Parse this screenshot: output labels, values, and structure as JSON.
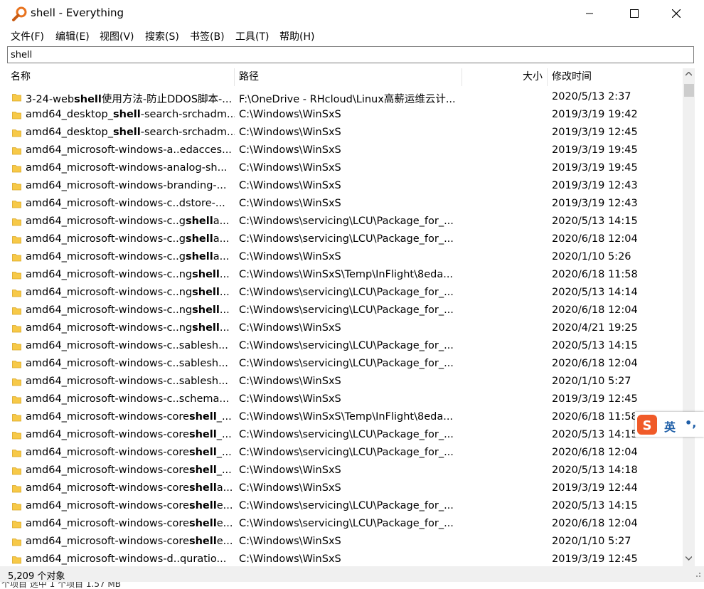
{
  "window": {
    "title": "shell - Everything"
  },
  "menu": [
    "文件(F)",
    "编辑(E)",
    "视图(V)",
    "搜索(S)",
    "书签(B)",
    "工具(T)",
    "帮助(H)"
  ],
  "search": {
    "value": "shell"
  },
  "columns": {
    "name": "名称",
    "path": "路径",
    "size": "大小",
    "modified": "修改时间"
  },
  "rows": [
    {
      "name": "3-24-webshell使用方法-防止DDOS脚本-...",
      "path": "F:\\OneDrive - RHcloud\\Linux高薪运维云计...",
      "date": "2020/5/13 2:37"
    },
    {
      "name": "amd64_desktop_shell-search-srchadm...",
      "path": "C:\\Windows\\WinSxS",
      "date": "2019/3/19 19:42"
    },
    {
      "name": "amd64_desktop_shell-search-srchadm...",
      "path": "C:\\Windows\\WinSxS",
      "date": "2019/3/19 12:45"
    },
    {
      "name": "amd64_microsoft-windows-a..edacces...",
      "path": "C:\\Windows\\WinSxS",
      "date": "2019/3/19 19:45"
    },
    {
      "name": "amd64_microsoft-windows-analog-sh...",
      "path": "C:\\Windows\\WinSxS",
      "date": "2019/3/19 19:45"
    },
    {
      "name": "amd64_microsoft-windows-branding-...",
      "path": "C:\\Windows\\WinSxS",
      "date": "2019/3/19 12:43"
    },
    {
      "name": "amd64_microsoft-windows-c..dstore-...",
      "path": "C:\\Windows\\WinSxS",
      "date": "2019/3/19 12:43"
    },
    {
      "name": "amd64_microsoft-windows-c..gshella...",
      "path": "C:\\Windows\\servicing\\LCU\\Package_for_...",
      "date": "2020/5/13 14:15"
    },
    {
      "name": "amd64_microsoft-windows-c..gshella...",
      "path": "C:\\Windows\\servicing\\LCU\\Package_for_...",
      "date": "2020/6/18 12:04"
    },
    {
      "name": "amd64_microsoft-windows-c..gshella...",
      "path": "C:\\Windows\\WinSxS",
      "date": "2020/1/10 5:26"
    },
    {
      "name": "amd64_microsoft-windows-c..ngshell...",
      "path": "C:\\Windows\\WinSxS\\Temp\\InFlight\\8eda...",
      "date": "2020/6/18 11:58"
    },
    {
      "name": "amd64_microsoft-windows-c..ngshell...",
      "path": "C:\\Windows\\servicing\\LCU\\Package_for_...",
      "date": "2020/5/13 14:14"
    },
    {
      "name": "amd64_microsoft-windows-c..ngshell...",
      "path": "C:\\Windows\\servicing\\LCU\\Package_for_...",
      "date": "2020/6/18 12:04"
    },
    {
      "name": "amd64_microsoft-windows-c..ngshell...",
      "path": "C:\\Windows\\WinSxS",
      "date": "2020/4/21 19:25"
    },
    {
      "name": "amd64_microsoft-windows-c..sablesh...",
      "path": "C:\\Windows\\servicing\\LCU\\Package_for_...",
      "date": "2020/5/13 14:15"
    },
    {
      "name": "amd64_microsoft-windows-c..sablesh...",
      "path": "C:\\Windows\\servicing\\LCU\\Package_for_...",
      "date": "2020/6/18 12:04"
    },
    {
      "name": "amd64_microsoft-windows-c..sablesh...",
      "path": "C:\\Windows\\WinSxS",
      "date": "2020/1/10 5:27"
    },
    {
      "name": "amd64_microsoft-windows-c..schema...",
      "path": "C:\\Windows\\WinSxS",
      "date": "2019/3/19 12:45"
    },
    {
      "name": "amd64_microsoft-windows-coreshell_...",
      "path": "C:\\Windows\\WinSxS\\Temp\\InFlight\\8eda...",
      "date": "2020/6/18 11:58"
    },
    {
      "name": "amd64_microsoft-windows-coreshell_...",
      "path": "C:\\Windows\\servicing\\LCU\\Package_for_...",
      "date": "2020/5/13 14:15"
    },
    {
      "name": "amd64_microsoft-windows-coreshell_...",
      "path": "C:\\Windows\\servicing\\LCU\\Package_for_...",
      "date": "2020/6/18 12:04"
    },
    {
      "name": "amd64_microsoft-windows-coreshell_...",
      "path": "C:\\Windows\\WinSxS",
      "date": "2020/5/13 14:18"
    },
    {
      "name": "amd64_microsoft-windows-coreshella...",
      "path": "C:\\Windows\\WinSxS",
      "date": "2019/3/19 12:44"
    },
    {
      "name": "amd64_microsoft-windows-coreshelle...",
      "path": "C:\\Windows\\servicing\\LCU\\Package_for_...",
      "date": "2020/5/13 14:15"
    },
    {
      "name": "amd64_microsoft-windows-coreshelle...",
      "path": "C:\\Windows\\servicing\\LCU\\Package_for_...",
      "date": "2020/6/18 12:04"
    },
    {
      "name": "amd64_microsoft-windows-coreshelle...",
      "path": "C:\\Windows\\WinSxS",
      "date": "2020/1/10 5:27"
    },
    {
      "name": "amd64_microsoft-windows-d..quratio...",
      "path": "C:\\Windows\\WinSxS",
      "date": "2019/3/19 12:45"
    }
  ],
  "highlight": "shell",
  "status": {
    "count": "5,209 个对象"
  },
  "ime": {
    "label": "英",
    "extra": "•,"
  },
  "background_strip": "个项目    选中 1 个项目  1.57 MB",
  "colors": {
    "folder": "#f7c948",
    "ime_brand": "#f05a28"
  }
}
